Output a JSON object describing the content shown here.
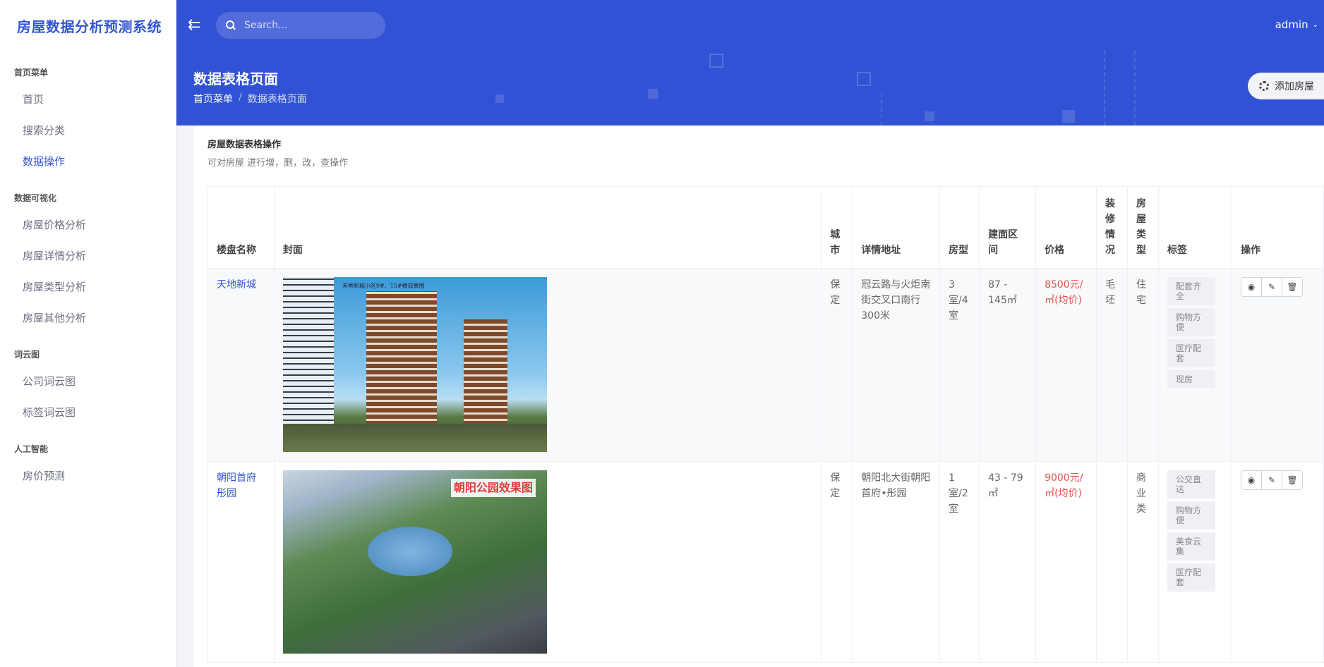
{
  "sidebar": {
    "brand": "房屋数据分析预测系统",
    "sections": [
      {
        "title": "首页菜单",
        "items": [
          "首页",
          "搜索分类",
          "数据操作"
        ]
      },
      {
        "title": "数据可视化",
        "items": [
          "房屋价格分析",
          "房屋详情分析",
          "房屋类型分析",
          "房屋其他分析"
        ]
      },
      {
        "title": "词云图",
        "items": [
          "公司词云图",
          "标签词云图"
        ]
      },
      {
        "title": "人工智能",
        "items": [
          "房价预测"
        ]
      }
    ],
    "active_item": "数据操作"
  },
  "header": {
    "search_placeholder": "Search...",
    "user": "admin",
    "page_title": "数据表格页面",
    "breadcrumb": [
      "首页菜单",
      "数据表格页面"
    ],
    "add_button": "添加房屋"
  },
  "card": {
    "title": "房屋数据表格操作",
    "subtitle": "可对房屋 进行增，删，改，查操作"
  },
  "table": {
    "headers": [
      "楼盘名称",
      "封面",
      "城市",
      "详情地址",
      "房型",
      "建面区间",
      "价格",
      "装修情况",
      "房屋类型",
      "标签",
      "操作"
    ],
    "rows": [
      {
        "name": "天地新城",
        "cover_caption": "天地新城小区9#、15#楼效果图",
        "city": "保定",
        "address": "冠云路与火炬南街交叉口南行300米",
        "layout": "3室/4室",
        "area": "87 - 145㎡",
        "price": "8500元/㎡(均价)",
        "decoration": "毛坯",
        "type": "住宅",
        "tags": [
          "配套齐全",
          "购物方便",
          "医疗配套",
          "现房"
        ]
      },
      {
        "name": "朝阳首府彤园",
        "cover_caption": "朝阳公园效果图",
        "city": "保定",
        "address": "朝阳北大街朝阳首府•彤园",
        "layout": "1室/2室",
        "area": "43 - 79㎡",
        "price": "9000元/㎡(均价)",
        "decoration": "",
        "type": "商业类",
        "tags": [
          "公交直达",
          "购物方便",
          "美食云集",
          "医疗配套"
        ]
      }
    ]
  },
  "icons": {
    "menu": "arrow-left-menu-icon",
    "search": "search-icon",
    "user_dropdown": "chevron-down-icon",
    "add": "gear-icon",
    "view": "eye-icon",
    "edit": "pencil-icon",
    "delete": "trash-icon"
  },
  "colors": {
    "primary": "#3152d4",
    "price": "#e2534b",
    "link": "#3556d4"
  }
}
